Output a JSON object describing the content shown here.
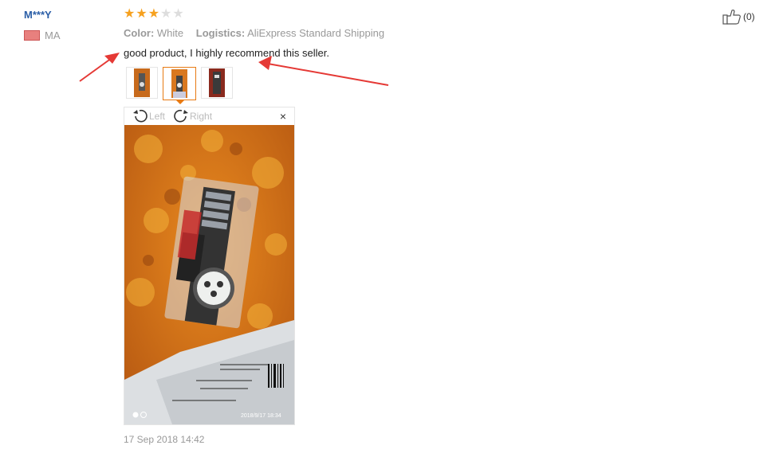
{
  "reviewer": {
    "name": "M***Y",
    "country_code": "MA"
  },
  "rating": {
    "value": 3,
    "max": 5
  },
  "meta": {
    "color_label": "Color:",
    "color_value": "White",
    "logistics_label": "Logistics:",
    "logistics_value": "AliExpress Standard Shipping"
  },
  "review_text": "good product, I highly recommend this seller.",
  "helpful": {
    "count": "(0)"
  },
  "viewer": {
    "rotate_left_label": "Left",
    "rotate_right_label": "Right",
    "close_glyph": "×",
    "photo_timestamp": "2018/9/17 18:34"
  },
  "review_date": "17 Sep 2018 14:42",
  "colors": {
    "star_on": "#f6a11f",
    "star_off": "#dddddd",
    "accent": "#e87a12",
    "name": "#2b5ea7",
    "arrow": "#e53935"
  }
}
